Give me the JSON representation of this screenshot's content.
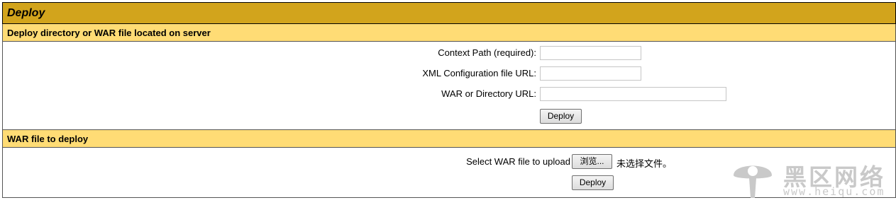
{
  "title": "Deploy",
  "server_deploy": {
    "header": "Deploy directory or WAR file located on server",
    "context_path_label": "Context Path (required):",
    "context_path_value": "",
    "config_url_label": "XML Configuration file URL:",
    "config_url_value": "",
    "war_url_label": "WAR or Directory URL:",
    "war_url_value": "",
    "deploy_button": "Deploy"
  },
  "upload_deploy": {
    "header": "WAR file to deploy",
    "select_label": "Select WAR file to upload",
    "browse_button": "浏览...",
    "no_file_text": "未选择文件。",
    "deploy_button": "Deploy"
  },
  "watermark": {
    "title": "黑区网络",
    "url": "www.heiqu.com",
    "icon": "mushroom-logo-icon"
  },
  "colors": {
    "title_bar": "#d2a41c",
    "section_header": "#ffdc75"
  }
}
